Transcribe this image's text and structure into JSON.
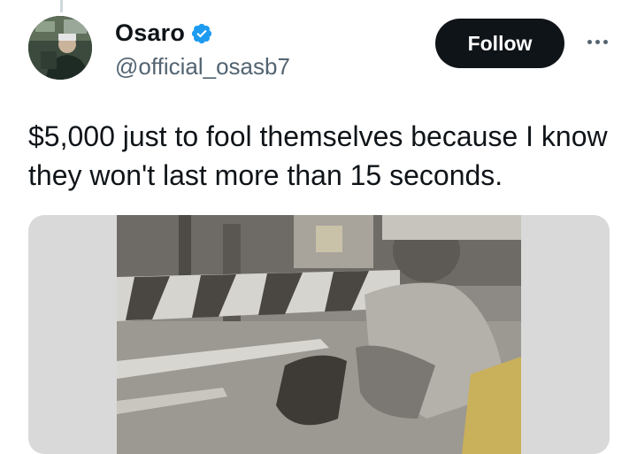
{
  "author": {
    "display_name": "Osaro",
    "handle": "@official_osasb7",
    "verified": true
  },
  "actions": {
    "follow_label": "Follow",
    "more_icon": "more-horizontal-icon"
  },
  "tweet": {
    "text": "$5,000 just to fool themselves because I know they won't last more than 15 seconds."
  },
  "colors": {
    "verified_blue": "#1d9bf0",
    "follow_bg": "#0f1419",
    "handle_gray": "#536471",
    "media_bg": "#d9d9d9"
  }
}
